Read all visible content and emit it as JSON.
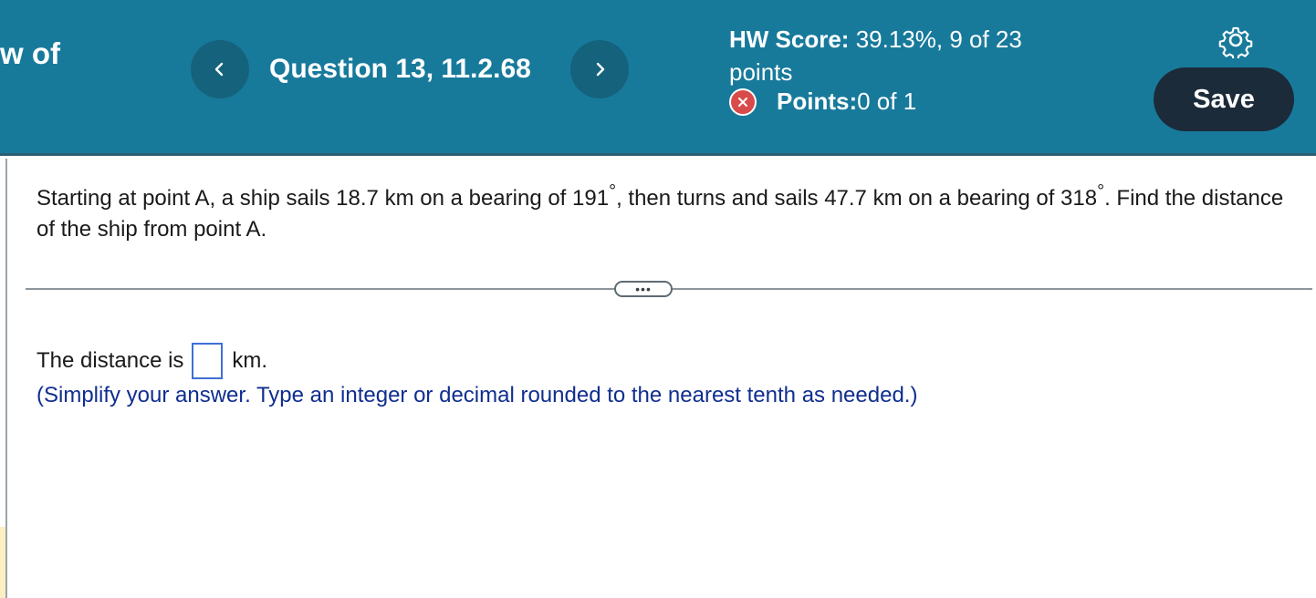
{
  "header": {
    "cut_title": "w of",
    "question_label": "Question 13, 11.2.68",
    "hw_score_label": "HW Score:",
    "hw_score_value": " 39.13%, 9 of 23 points",
    "points_label": "Points:",
    "points_value": " 0 of 1",
    "save_label": "Save"
  },
  "icons": {
    "prev": "chevron-left-icon",
    "next": "chevron-right-icon",
    "status": "x-circle-icon",
    "settings": "gear-icon"
  },
  "colors": {
    "header_bg": "#187a9b",
    "save_bg": "#1b2b3a",
    "incorrect": "#d94a4a",
    "hint_text": "#102e8f"
  },
  "question": {
    "text_part1": "Starting at point A, a ship sails 18.7 km on a bearing of 191",
    "degree1": "°",
    "text_part2": ", then turns and sails 47.7 km on a bearing of 318",
    "degree2": "°",
    "text_part3": ". Find the distance of the ship from point A."
  },
  "more_label": "•••",
  "answer": {
    "prefix": "The distance is",
    "value": "",
    "suffix": "km.",
    "hint": "(Simplify your answer. Type an integer or decimal rounded to the nearest tenth as needed.)"
  }
}
